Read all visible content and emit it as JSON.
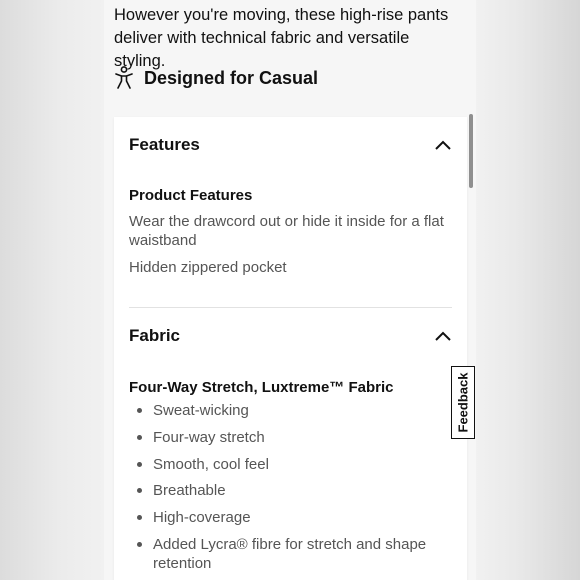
{
  "intro": {
    "text": "However you're moving, these high-rise pants deliver with technical fabric and versatile styling."
  },
  "designed_for": {
    "label": "Designed for Casual",
    "icon": "person-activity-icon"
  },
  "features": {
    "title": "Features",
    "state": "expanded",
    "subheading": "Product Features",
    "items": [
      "Wear the drawcord out or hide it inside for a flat waistband",
      "Hidden zippered pocket"
    ]
  },
  "fabric": {
    "title": "Fabric",
    "state": "expanded",
    "subheading": "Four-Way Stretch, Luxtreme™ Fabric",
    "items": [
      "Sweat-wicking",
      "Four-way stretch",
      "Smooth, cool feel",
      "Breathable",
      "High-coverage",
      "Added Lycra® fibre for stretch and shape retention"
    ]
  },
  "feedback_tab": {
    "label": "Feedback"
  }
}
